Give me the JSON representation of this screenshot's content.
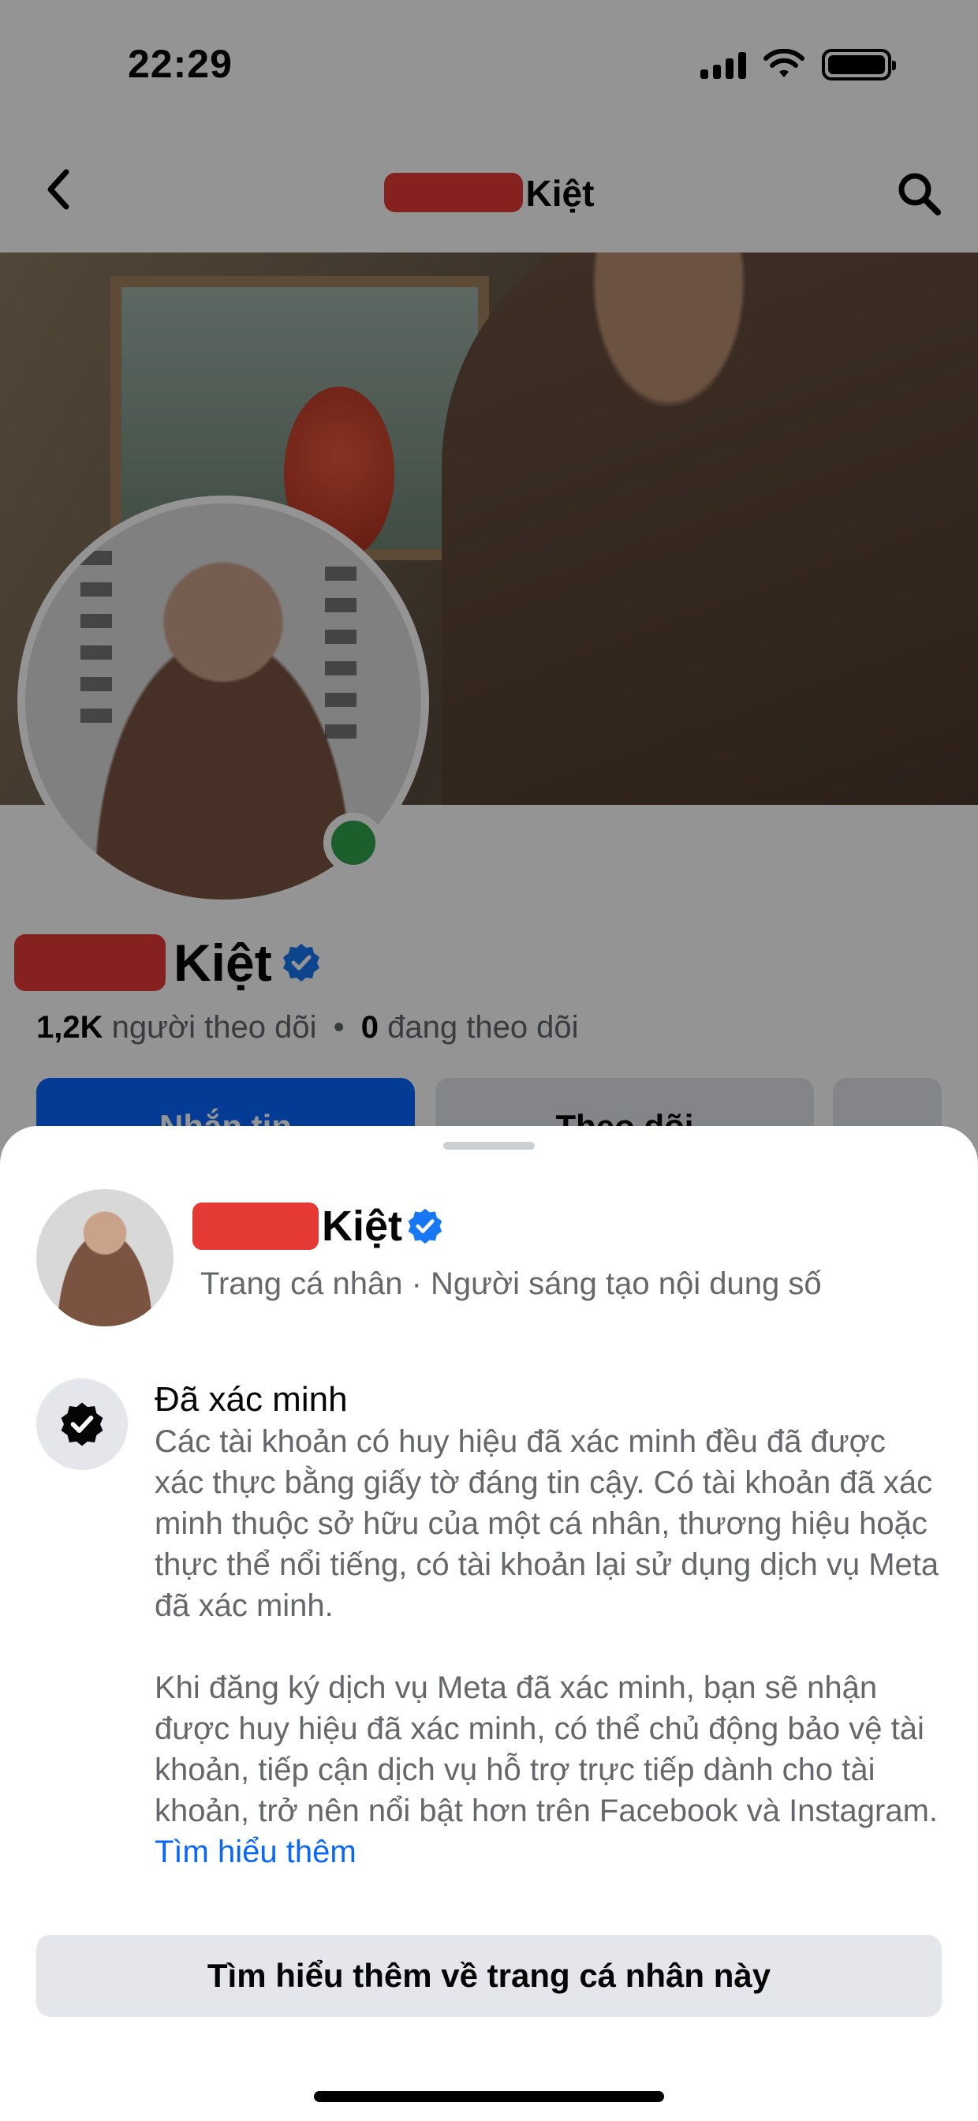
{
  "status_bar": {
    "time": "22:29"
  },
  "nav": {
    "title_suffix": "Kiệt",
    "back_icon": "chevron-left-icon",
    "search_icon": "search-icon"
  },
  "profile": {
    "name_suffix": "Kiệt",
    "followers_count": "1,2K",
    "followers_label": "người theo dõi",
    "separator": "•",
    "following_count": "0",
    "following_label": "đang theo dõi",
    "message_label": "Nhắn tin",
    "follow_label": "Theo dõi",
    "more_label": "..."
  },
  "sheet": {
    "name_suffix": "Kiệt",
    "subtitle": "Trang cá nhân · Người sáng tạo nội dung số",
    "verified_title": "Đã xác minh",
    "verified_body_1": "Các tài khoản có huy hiệu đã xác minh đều đã được xác thực bằng giấy tờ đáng tin cậy. Có tài khoản đã xác minh thuộc sở hữu của một cá nhân, thương hiệu hoặc thực thể nổi tiếng, có tài khoản lại sử dụng dịch vụ Meta đã xác minh.",
    "verified_body_2": "Khi đăng ký dịch vụ Meta đã xác minh, bạn sẽ nhận được huy hiệu đã xác minh, có thể chủ động bảo vệ tài khoản, tiếp cận dịch vụ hỗ trợ trực tiếp dành cho tài khoản, trở nên nổi bật hơn trên Facebook và Instagram.",
    "learn_more_link": "Tìm hiểu thêm",
    "learn_more_button": "Tìm hiểu thêm về trang cá nhân này"
  },
  "colors": {
    "accent": "#0866ff",
    "verified": "#1877f2",
    "online": "#31a24c",
    "redaction": "#e53935"
  }
}
